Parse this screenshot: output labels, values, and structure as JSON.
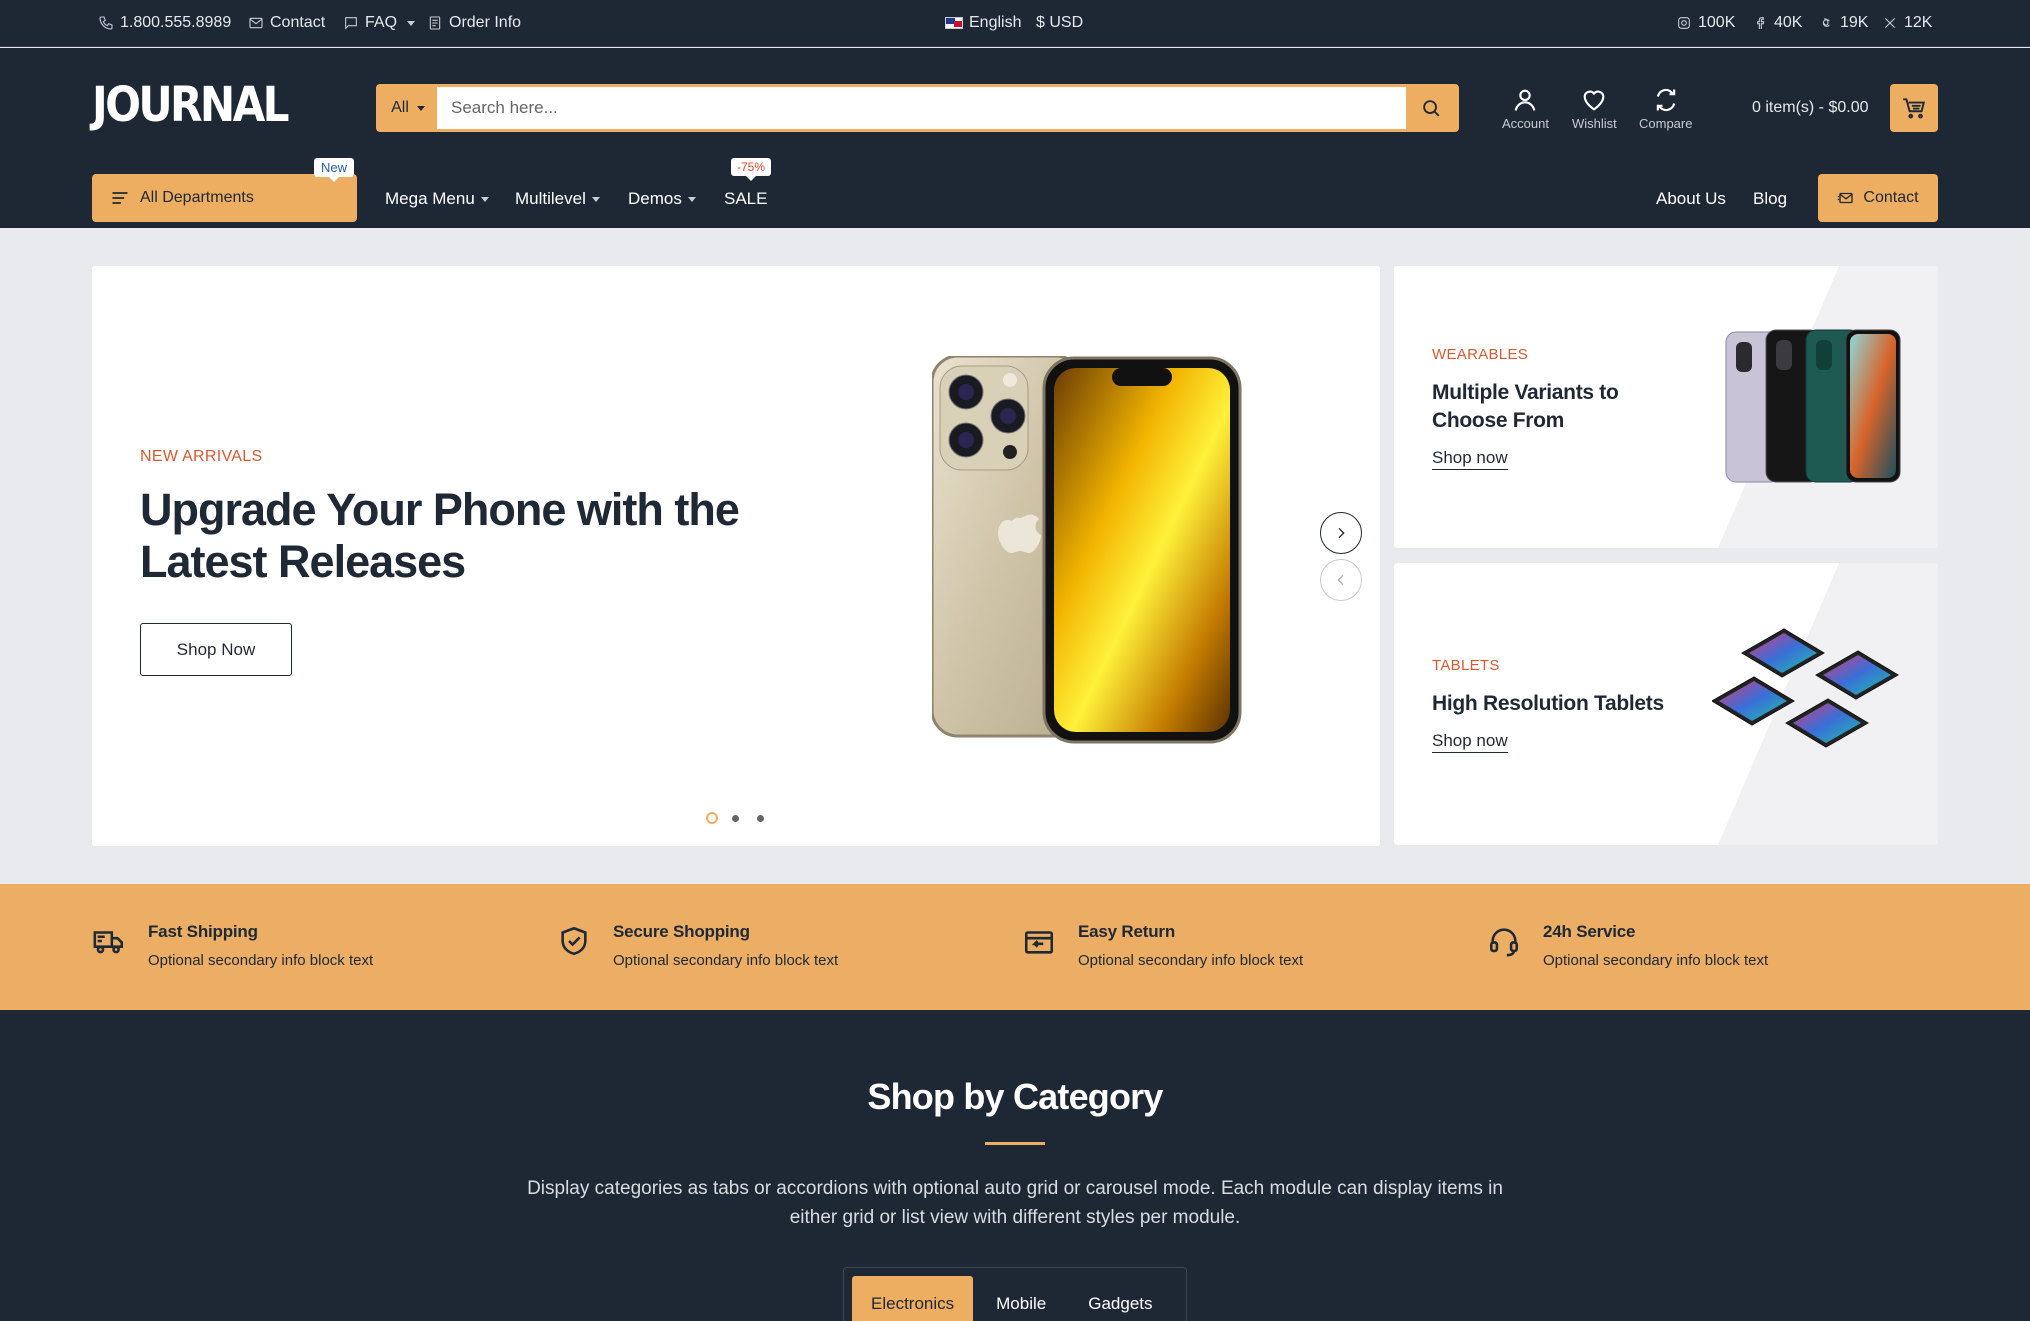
{
  "topbar": {
    "phone": "1.800.555.8989",
    "contact": "Contact",
    "faq": "FAQ",
    "order_info": "Order Info",
    "language": "English",
    "currency": "$ USD",
    "social": [
      {
        "icon": "instagram-icon",
        "count": "100K"
      },
      {
        "icon": "facebook-icon",
        "count": "40K"
      },
      {
        "icon": "threads-icon",
        "count": "19K"
      },
      {
        "icon": "x-icon",
        "count": "12K"
      }
    ]
  },
  "header": {
    "logo": "JOURNAL",
    "search_category": "All",
    "search_placeholder": "Search here...",
    "account": "Account",
    "wishlist": "Wishlist",
    "compare": "Compare",
    "cart": "0 item(s) - $0.00"
  },
  "nav": {
    "departments": "All Departments",
    "departments_badge": "New",
    "mega_menu": "Mega Menu",
    "multilevel": "Multilevel",
    "demos": "Demos",
    "sale": "SALE",
    "sale_badge": "-75%",
    "about": "About Us",
    "blog": "Blog",
    "contact": "Contact"
  },
  "hero": {
    "kicker": "NEW ARRIVALS",
    "title": "Upgrade Your Phone with the Latest Releases",
    "button": "Shop Now",
    "slides": 3,
    "active_slide": 1
  },
  "banners": [
    {
      "kicker": "WEARABLES",
      "title": "Multiple Variants to Choose From",
      "link": "Shop now"
    },
    {
      "kicker": "TABLETS",
      "title": "High Resolution Tablets",
      "link": "Shop now"
    }
  ],
  "features": [
    {
      "icon": "truck-icon",
      "title": "Fast Shipping",
      "subtitle": "Optional secondary info block text"
    },
    {
      "icon": "shield-check-icon",
      "title": "Secure Shopping",
      "subtitle": "Optional secondary info block text"
    },
    {
      "icon": "return-box-icon",
      "title": "Easy Return",
      "subtitle": "Optional secondary info block text"
    },
    {
      "icon": "headset-icon",
      "title": "24h Service",
      "subtitle": "Optional secondary info block text"
    }
  ],
  "categories": {
    "title": "Shop by Category",
    "description": "Display categories as tabs or accordions with optional auto grid or carousel mode. Each module can display items in either grid or list view with different styles per module.",
    "tabs": [
      "Electronics",
      "Mobile",
      "Gadgets"
    ],
    "active_tab": "Electronics"
  },
  "colors": {
    "dark": "#1e2835",
    "accent": "#eeae62",
    "kicker": "#d8592f"
  }
}
